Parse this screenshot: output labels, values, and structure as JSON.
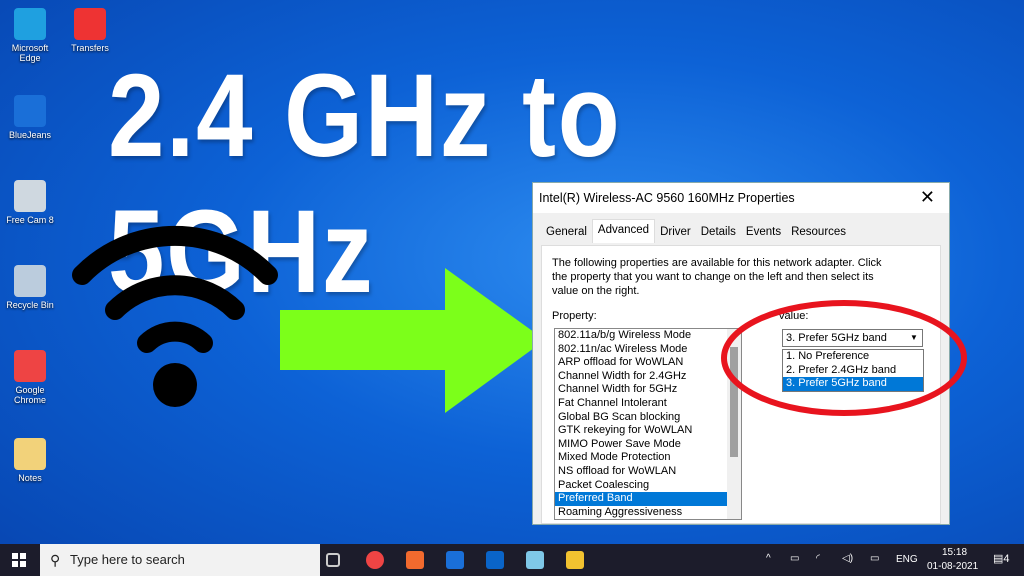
{
  "headline": "2.4 GHz to 5GHz",
  "desktop_icons": [
    {
      "label": "Microsoft Edge",
      "icon": "edge-icon",
      "color": "#1fa0e0"
    },
    {
      "label": "Transfers",
      "icon": "pdf-icon",
      "color": "#e33"
    },
    {
      "label": "BlueJeans",
      "icon": "bluejeans-icon",
      "color": "#1a6fd8"
    },
    {
      "label": "Free Cam 8",
      "icon": "freecam-icon",
      "color": "#cfd8e0"
    },
    {
      "label": "Recycle Bin",
      "icon": "recycle-bin-icon",
      "color": "#bcd"
    },
    {
      "label": "Google Chrome",
      "icon": "chrome-icon",
      "color": "#e44"
    },
    {
      "label": "Notes",
      "icon": "folder-icon",
      "color": "#f2d27a"
    }
  ],
  "colors": {
    "arrow": "#7cff1a",
    "circle": "#e8141e",
    "selection": "#0078d7"
  },
  "dialog": {
    "title": "Intel(R) Wireless-AC 9560 160MHz Properties",
    "tabs": [
      "General",
      "Advanced",
      "Driver",
      "Details",
      "Events",
      "Resources"
    ],
    "active_tab": "Advanced",
    "description": "The following properties are available for this network adapter. Click the property that you want to change on the left and then select its value on the right.",
    "property_label": "Property:",
    "value_label": "Value:",
    "properties": [
      "802.11a/b/g Wireless Mode",
      "802.11n/ac Wireless Mode",
      "ARP offload for WoWLAN",
      "Channel Width for 2.4GHz",
      "Channel Width for 5GHz",
      "Fat Channel Intolerant",
      "Global BG Scan blocking",
      "GTK rekeying for WoWLAN",
      "MIMO Power Save Mode",
      "Mixed Mode Protection",
      "NS offload for WoWLAN",
      "Packet Coalescing",
      "Preferred Band",
      "Roaming Aggressiveness"
    ],
    "selected_property": "Preferred Band",
    "value_selected": "3. Prefer 5GHz band",
    "value_options": [
      "1. No Preference",
      "2. Prefer 2.4GHz band",
      "3. Prefer 5GHz band"
    ]
  },
  "taskbar": {
    "search_placeholder": "Type here to search",
    "language": "ENG",
    "time": "15:18",
    "date": "01-08-2021",
    "notifications": "4"
  }
}
